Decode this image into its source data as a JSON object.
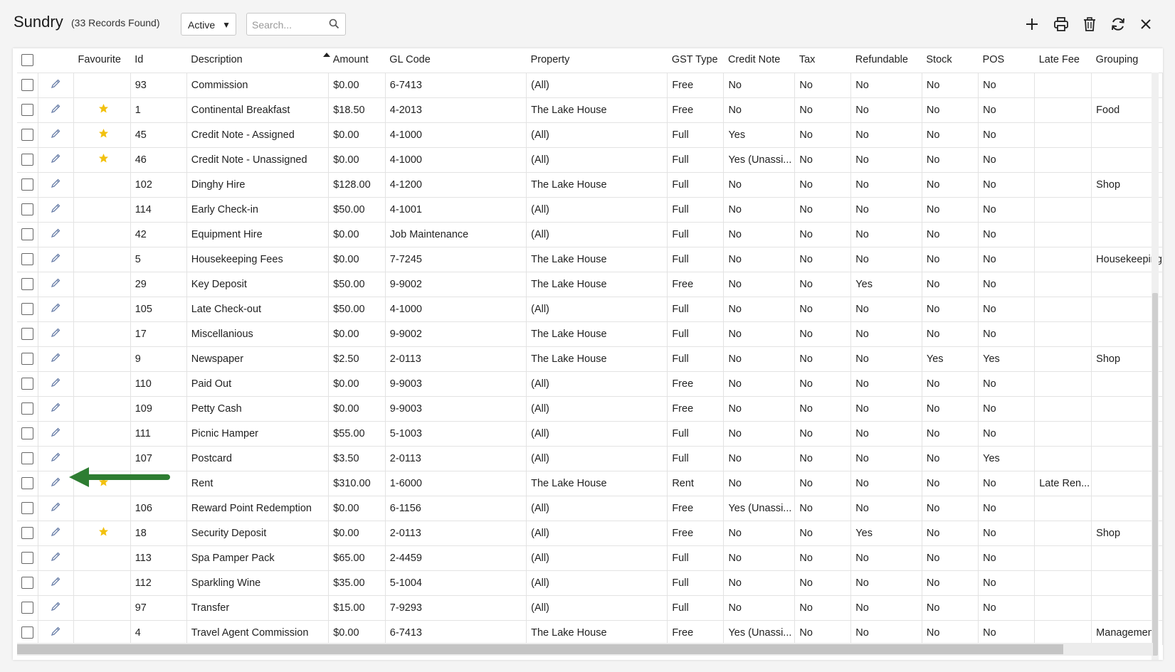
{
  "header": {
    "title": "Sundry",
    "record_count": "(33 Records Found)",
    "status_filter": "Active",
    "search_placeholder": "Search..."
  },
  "toolbar": {
    "icons": [
      "plus-icon",
      "print-icon",
      "trash-icon",
      "refresh-icon",
      "close-icon"
    ]
  },
  "colors": {
    "accent_green": "#2e7d32",
    "star": "#f2c10f",
    "pencil": "#6a7fa8"
  },
  "table": {
    "columns": [
      "Favourite",
      "Id",
      "Description",
      "Amount",
      "GL Code",
      "Property",
      "GST Type",
      "Credit Note",
      "Tax",
      "Refundable",
      "Stock",
      "POS",
      "Late Fee",
      "Grouping"
    ],
    "sorted_column": "Description",
    "rows": [
      {
        "fav": false,
        "id": "93",
        "desc": "Commission",
        "amount": "$0.00",
        "gl": "6-7413",
        "property": "(All)",
        "gst": "Free",
        "credit": "No",
        "tax": "No",
        "refundable": "No",
        "stock": "No",
        "pos": "No",
        "late_fee": "",
        "grouping": ""
      },
      {
        "fav": true,
        "id": "1",
        "desc": "Continental Breakfast",
        "amount": "$18.50",
        "gl": "4-2013",
        "property": "The Lake House",
        "gst": "Free",
        "credit": "No",
        "tax": "No",
        "refundable": "No",
        "stock": "No",
        "pos": "No",
        "late_fee": "",
        "grouping": "Food"
      },
      {
        "fav": true,
        "id": "45",
        "desc": "Credit Note - Assigned",
        "amount": "$0.00",
        "gl": "4-1000",
        "property": "(All)",
        "gst": "Full",
        "credit": "Yes",
        "tax": "No",
        "refundable": "No",
        "stock": "No",
        "pos": "No",
        "late_fee": "",
        "grouping": ""
      },
      {
        "fav": true,
        "id": "46",
        "desc": "Credit Note - Unassigned",
        "amount": "$0.00",
        "gl": "4-1000",
        "property": "(All)",
        "gst": "Full",
        "credit": "Yes (Unassi...",
        "tax": "No",
        "refundable": "No",
        "stock": "No",
        "pos": "No",
        "late_fee": "",
        "grouping": ""
      },
      {
        "fav": false,
        "id": "102",
        "desc": "Dinghy Hire",
        "amount": "$128.00",
        "gl": "4-1200",
        "property": "The Lake House",
        "gst": "Full",
        "credit": "No",
        "tax": "No",
        "refundable": "No",
        "stock": "No",
        "pos": "No",
        "late_fee": "",
        "grouping": "Shop"
      },
      {
        "fav": false,
        "id": "114",
        "desc": "Early Check-in",
        "amount": "$50.00",
        "gl": "4-1001",
        "property": "(All)",
        "gst": "Full",
        "credit": "No",
        "tax": "No",
        "refundable": "No",
        "stock": "No",
        "pos": "No",
        "late_fee": "",
        "grouping": ""
      },
      {
        "fav": false,
        "id": "42",
        "desc": "Equipment Hire",
        "amount": "$0.00",
        "gl": "Job Maintenance",
        "property": "(All)",
        "gst": "Full",
        "credit": "No",
        "tax": "No",
        "refundable": "No",
        "stock": "No",
        "pos": "No",
        "late_fee": "",
        "grouping": ""
      },
      {
        "fav": false,
        "id": "5",
        "desc": "Housekeeping Fees",
        "amount": "$0.00",
        "gl": "7-7245",
        "property": "The Lake House",
        "gst": "Full",
        "credit": "No",
        "tax": "No",
        "refundable": "No",
        "stock": "No",
        "pos": "No",
        "late_fee": "",
        "grouping": "Housekeeping"
      },
      {
        "fav": false,
        "id": "29",
        "desc": "Key Deposit",
        "amount": "$50.00",
        "gl": "9-9002",
        "property": "The Lake House",
        "gst": "Free",
        "credit": "No",
        "tax": "No",
        "refundable": "Yes",
        "stock": "No",
        "pos": "No",
        "late_fee": "",
        "grouping": ""
      },
      {
        "fav": false,
        "id": "105",
        "desc": "Late Check-out",
        "amount": "$50.00",
        "gl": "4-1000",
        "property": "(All)",
        "gst": "Full",
        "credit": "No",
        "tax": "No",
        "refundable": "No",
        "stock": "No",
        "pos": "No",
        "late_fee": "",
        "grouping": ""
      },
      {
        "fav": false,
        "id": "17",
        "desc": "Miscellanious",
        "amount": "$0.00",
        "gl": "9-9002",
        "property": "The Lake House",
        "gst": "Full",
        "credit": "No",
        "tax": "No",
        "refundable": "No",
        "stock": "No",
        "pos": "No",
        "late_fee": "",
        "grouping": ""
      },
      {
        "fav": false,
        "id": "9",
        "desc": "Newspaper",
        "amount": "$2.50",
        "gl": "2-0113",
        "property": "The Lake House",
        "gst": "Full",
        "credit": "No",
        "tax": "No",
        "refundable": "No",
        "stock": "Yes",
        "pos": "Yes",
        "late_fee": "",
        "grouping": "Shop"
      },
      {
        "fav": false,
        "id": "110",
        "desc": "Paid Out",
        "amount": "$0.00",
        "gl": "9-9003",
        "property": "(All)",
        "gst": "Free",
        "credit": "No",
        "tax": "No",
        "refundable": "No",
        "stock": "No",
        "pos": "No",
        "late_fee": "",
        "grouping": ""
      },
      {
        "fav": false,
        "id": "109",
        "desc": "Petty Cash",
        "amount": "$0.00",
        "gl": "9-9003",
        "property": "(All)",
        "gst": "Free",
        "credit": "No",
        "tax": "No",
        "refundable": "No",
        "stock": "No",
        "pos": "No",
        "late_fee": "",
        "grouping": ""
      },
      {
        "fav": false,
        "id": "111",
        "desc": "Picnic Hamper",
        "amount": "$55.00",
        "gl": "5-1003",
        "property": "(All)",
        "gst": "Full",
        "credit": "No",
        "tax": "No",
        "refundable": "No",
        "stock": "No",
        "pos": "No",
        "late_fee": "",
        "grouping": ""
      },
      {
        "fav": false,
        "id": "107",
        "desc": "Postcard",
        "amount": "$3.50",
        "gl": "2-0113",
        "property": "(All)",
        "gst": "Full",
        "credit": "No",
        "tax": "No",
        "refundable": "No",
        "stock": "No",
        "pos": "Yes",
        "late_fee": "",
        "grouping": ""
      },
      {
        "fav": true,
        "id": "",
        "desc": "Rent",
        "amount": "$310.00",
        "gl": "1-6000",
        "property": "The Lake House",
        "gst": "Rent",
        "credit": "No",
        "tax": "No",
        "refundable": "No",
        "stock": "No",
        "pos": "No",
        "late_fee": "Late Ren...",
        "grouping": ""
      },
      {
        "fav": false,
        "id": "106",
        "desc": "Reward Point Redemption",
        "amount": "$0.00",
        "gl": "6-1156",
        "property": "(All)",
        "gst": "Free",
        "credit": "Yes (Unassi...",
        "tax": "No",
        "refundable": "No",
        "stock": "No",
        "pos": "No",
        "late_fee": "",
        "grouping": ""
      },
      {
        "fav": true,
        "id": "18",
        "desc": "Security Deposit",
        "amount": "$0.00",
        "gl": "2-0113",
        "property": "(All)",
        "gst": "Free",
        "credit": "No",
        "tax": "No",
        "refundable": "Yes",
        "stock": "No",
        "pos": "No",
        "late_fee": "",
        "grouping": "Shop"
      },
      {
        "fav": false,
        "id": "113",
        "desc": "Spa Pamper Pack",
        "amount": "$65.00",
        "gl": "2-4459",
        "property": "(All)",
        "gst": "Full",
        "credit": "No",
        "tax": "No",
        "refundable": "No",
        "stock": "No",
        "pos": "No",
        "late_fee": "",
        "grouping": ""
      },
      {
        "fav": false,
        "id": "112",
        "desc": "Sparkling Wine",
        "amount": "$35.00",
        "gl": "5-1004",
        "property": "(All)",
        "gst": "Full",
        "credit": "No",
        "tax": "No",
        "refundable": "No",
        "stock": "No",
        "pos": "No",
        "late_fee": "",
        "grouping": ""
      },
      {
        "fav": false,
        "id": "97",
        "desc": "Transfer",
        "amount": "$15.00",
        "gl": "7-9293",
        "property": "(All)",
        "gst": "Full",
        "credit": "No",
        "tax": "No",
        "refundable": "No",
        "stock": "No",
        "pos": "No",
        "late_fee": "",
        "grouping": ""
      },
      {
        "fav": false,
        "id": "4",
        "desc": "Travel Agent Commission",
        "amount": "$0.00",
        "gl": "6-7413",
        "property": "The Lake House",
        "gst": "Free",
        "credit": "Yes (Unassi...",
        "tax": "No",
        "refundable": "No",
        "stock": "No",
        "pos": "No",
        "late_fee": "",
        "grouping": "Management"
      }
    ]
  }
}
